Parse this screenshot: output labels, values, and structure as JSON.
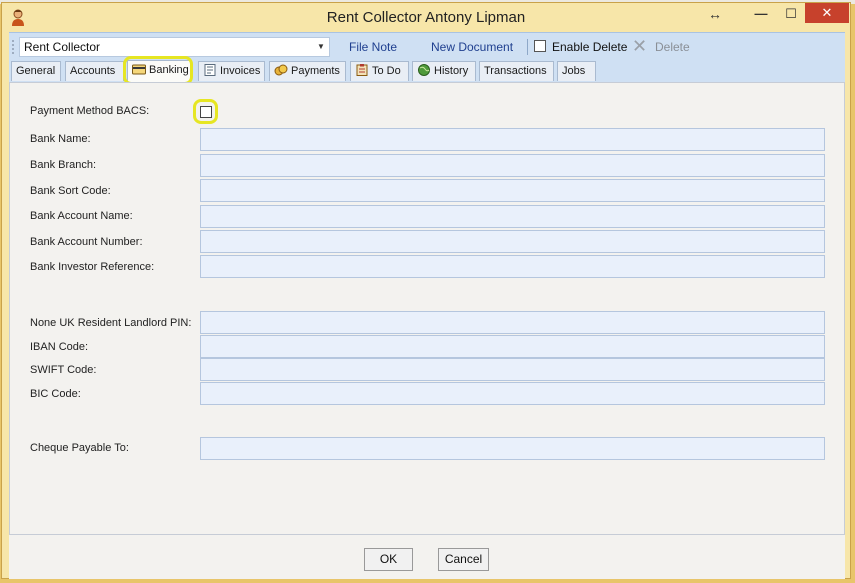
{
  "window": {
    "title": "Rent Collector Antony Lipman",
    "controls": {
      "resize": "↔",
      "minimize": "—",
      "maximize": "☐",
      "close": "✕"
    }
  },
  "toolbar": {
    "combo_value": "Rent Collector",
    "file_note": "File Note",
    "new_document": "New Document",
    "enable_delete": "Enable Delete",
    "delete": "Delete"
  },
  "tabs": [
    {
      "label": "General",
      "icon": ""
    },
    {
      "label": "Accounts",
      "icon": ""
    },
    {
      "label": "Banking",
      "icon": "credit-card-icon",
      "active": true
    },
    {
      "label": "Invoices",
      "icon": "invoice-icon"
    },
    {
      "label": "Payments",
      "icon": "coins-icon"
    },
    {
      "label": "To Do",
      "icon": "clipboard-icon"
    },
    {
      "label": "History",
      "icon": "globe-icon"
    },
    {
      "label": "Transactions",
      "icon": ""
    },
    {
      "label": "Jobs",
      "icon": ""
    }
  ],
  "form": {
    "payment_method_bacs": "Payment Method BACS:",
    "bank_name": "Bank Name:",
    "bank_branch": "Bank Branch:",
    "bank_sort_code": "Bank Sort Code:",
    "bank_account_name": "Bank Account Name:",
    "bank_account_number": "Bank Account Number:",
    "bank_investor_reference": "Bank Investor Reference:",
    "none_uk_resident_pin": "None UK Resident Landlord PIN:",
    "iban_code": "IBAN Code:",
    "swift_code": "SWIFT Code:",
    "bic_code": "BIC Code:",
    "cheque_payable_to": "Cheque Payable To:"
  },
  "buttons": {
    "ok": "OK",
    "cancel": "Cancel"
  },
  "colors": {
    "highlight": "#e6e623",
    "close_button": "#c7412c",
    "toolbar": "#cfe0f3",
    "input": "#e9f0fb"
  }
}
